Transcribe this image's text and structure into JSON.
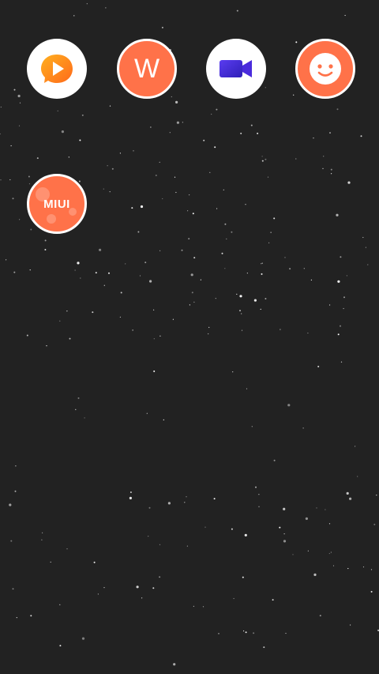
{
  "wallpaper": {
    "background_color": "#222222",
    "star_color": "#ffffff"
  },
  "apps": [
    {
      "name": "video-player-app",
      "icon": "play-icon",
      "bg": "#ffffff",
      "accent": "#ff8a1f"
    },
    {
      "name": "w-app",
      "icon": "letter-w-icon",
      "letter": "W",
      "bg": "#ff7249"
    },
    {
      "name": "video-call-app",
      "icon": "video-camera-icon",
      "bg": "#ffffff",
      "accent": "#4a2bdc"
    },
    {
      "name": "smiley-app",
      "icon": "smiley-face-icon",
      "bg": "#ff7249"
    },
    {
      "name": "miui-app",
      "icon": "miui-logo-icon",
      "label": "MIUI",
      "bg": "#ff7249"
    }
  ]
}
